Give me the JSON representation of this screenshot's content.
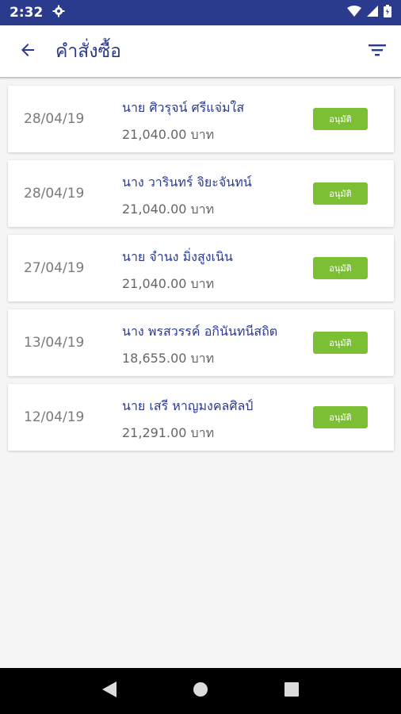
{
  "status_bar": {
    "time": "2:32"
  },
  "app_bar": {
    "title": "คำสั่งซื้อ"
  },
  "orders": [
    {
      "date": "28/04/19",
      "name": "นาย ศิวรุจน์ ศรีแจ่มใส",
      "amount": "21,040.00 บาท",
      "status": "อนุมัติ"
    },
    {
      "date": "28/04/19",
      "name": "นาง วารินทร์ จิยะจันทน์",
      "amount": "21,040.00 บาท",
      "status": "อนุมัติ"
    },
    {
      "date": "27/04/19",
      "name": "นาย  จำนง มิ่งสูงเนิน",
      "amount": "21,040.00 บาท",
      "status": "อนุมัติ"
    },
    {
      "date": "13/04/19",
      "name": "นาง พรสวรรค์ อกินันทนีสถิต",
      "amount": "18,655.00 บาท",
      "status": "อนุมัติ"
    },
    {
      "date": "12/04/19",
      "name": "นาย เสรี หาญมงคลศิลป์",
      "amount": "21,291.00 บาท",
      "status": "อนุมัติ"
    }
  ],
  "colors": {
    "status_bar": "#2a3a8c",
    "title": "#2b3a8f",
    "badge": "#7cbf35",
    "background": "#f5f5f5"
  },
  "icons": {
    "back": "arrow-left-icon",
    "filter": "filter-icon",
    "settings": "gear-icon",
    "wifi": "wifi-icon",
    "signal": "signal-icon",
    "battery": "battery-icon",
    "nav_back": "triangle-back-icon",
    "nav_home": "circle-home-icon",
    "nav_recents": "square-recents-icon"
  }
}
